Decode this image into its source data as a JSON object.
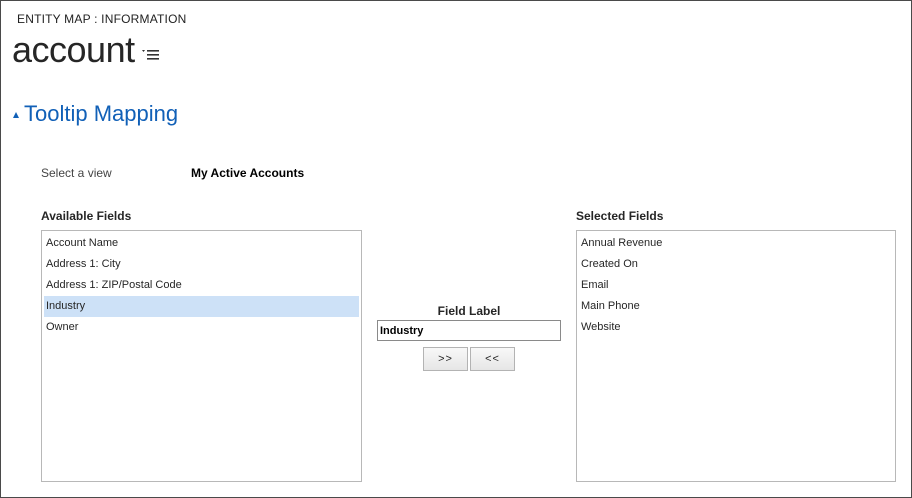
{
  "header": {
    "breadcrumb": "ENTITY MAP : INFORMATION",
    "entity_name": "account",
    "menu_icon": "list-menu-icon"
  },
  "section": {
    "title": "Tooltip Mapping",
    "collapse_icon": "collapse-triangle-icon",
    "accent_color": "#1160b7"
  },
  "view_selector": {
    "label": "Select a view",
    "value": "My Active Accounts"
  },
  "available_fields": {
    "label": "Available Fields",
    "items": [
      "Account Name",
      "Address 1: City",
      "Address 1: ZIP/Postal Code",
      "Industry",
      "Owner"
    ],
    "selected": "Industry"
  },
  "field_label": {
    "caption": "Field Label",
    "value": "Industry"
  },
  "buttons": {
    "add": ">>",
    "remove": "<<"
  },
  "selected_fields": {
    "label": "Selected Fields",
    "items": [
      "Annual Revenue",
      "Created On",
      "Email",
      "Main Phone",
      "Website"
    ]
  },
  "colors": {
    "selection_bg": "#cde1f7",
    "border": "#b8b8b8"
  }
}
